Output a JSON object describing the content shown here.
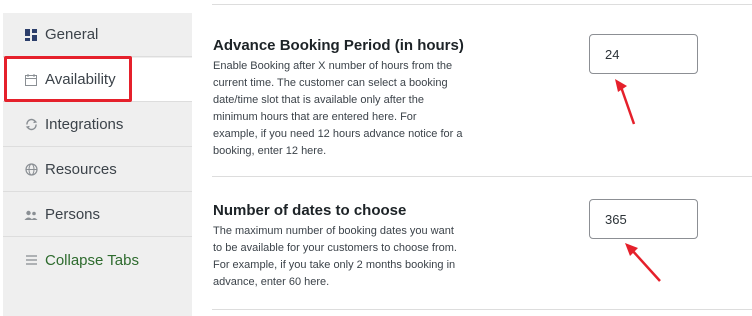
{
  "sidebar": {
    "tabs": [
      {
        "label": "General",
        "icon": "grid-icon"
      },
      {
        "label": "Availability",
        "icon": "calendar-icon"
      },
      {
        "label": "Integrations",
        "icon": "sync-icon"
      },
      {
        "label": "Resources",
        "icon": "globe-icon"
      },
      {
        "label": "Persons",
        "icon": "people-icon"
      },
      {
        "label": "Collapse Tabs",
        "icon": "menu-icon"
      }
    ]
  },
  "settings": {
    "advance_booking": {
      "title": "Advance Booking Period (in hours)",
      "description": "Enable Booking after X number of hours from the current time. The customer can select a booking date/time slot that is available only after the minimum hours that are entered here. For example, if you need 12 hours advance notice for a booking, enter 12 here.",
      "value": "24"
    },
    "dates_to_choose": {
      "title": "Number of dates to choose",
      "description": "The maximum number of booking dates you want to be available for your customers to choose from. For example, if you take only 2 months booking in advance, enter 60 here.",
      "value": "365"
    }
  },
  "colors": {
    "highlight": "#e5202b",
    "collapse_text": "#2e6b2e",
    "sidebar_bg": "#efefef"
  }
}
